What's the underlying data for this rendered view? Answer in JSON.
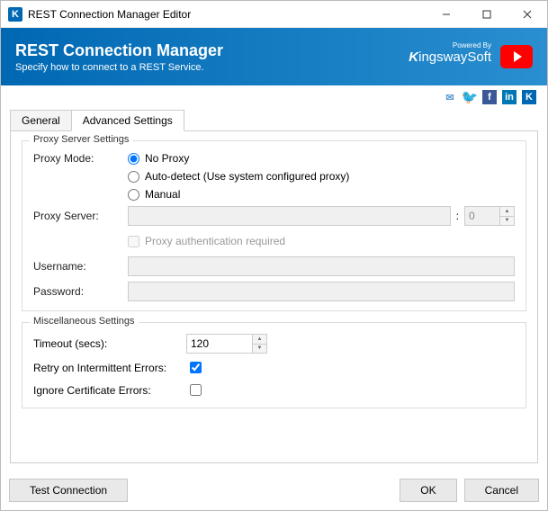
{
  "titlebar": {
    "icon": "K",
    "text": "REST Connection Manager Editor"
  },
  "banner": {
    "title": "REST Connection Manager",
    "subtitle": "Specify how to connect to a REST Service.",
    "brand_top": "Powered By",
    "brand": "ingswaySoft"
  },
  "tabs": {
    "general": "General",
    "advanced": "Advanced Settings"
  },
  "proxy": {
    "group_label": "Proxy Server Settings",
    "mode_label": "Proxy Mode:",
    "options": {
      "none": "No Proxy",
      "auto": "Auto-detect (Use system configured proxy)",
      "manual": "Manual"
    },
    "server_label": "Proxy Server:",
    "port_value": "0",
    "auth_label": "Proxy authentication required",
    "username_label": "Username:",
    "password_label": "Password:"
  },
  "misc": {
    "group_label": "Miscellaneous Settings",
    "timeout_label": "Timeout (secs):",
    "timeout_value": "120",
    "retry_label": "Retry on Intermittent Errors:",
    "ignore_label": "Ignore Certificate Errors:"
  },
  "footer": {
    "test": "Test Connection",
    "ok": "OK",
    "cancel": "Cancel"
  }
}
